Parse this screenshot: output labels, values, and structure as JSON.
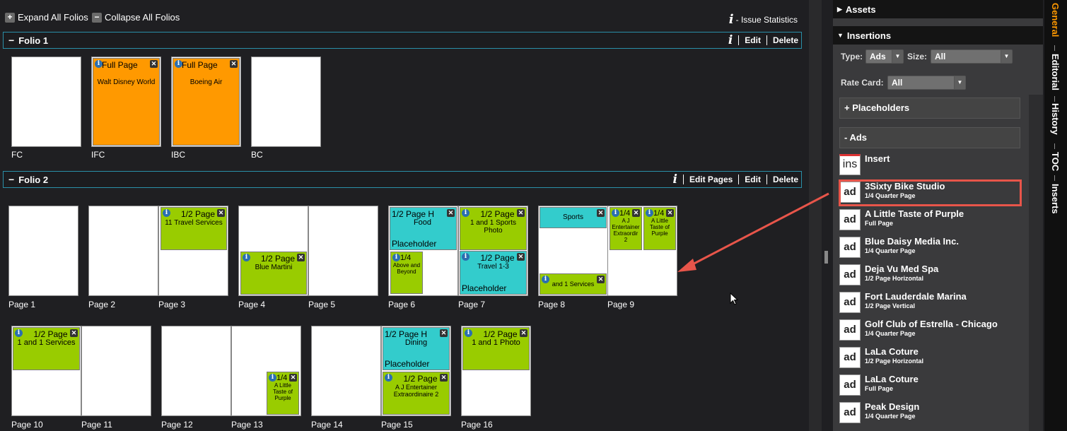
{
  "toolbar": {
    "expand_label": "Expand All Folios",
    "collapse_label": "Collapse All Folios",
    "stats_label": "- Issue Statistics",
    "stats_icon": "i"
  },
  "folios": [
    {
      "title": "Folio 1",
      "actions": [
        "Edit",
        "Delete"
      ]
    },
    {
      "title": "Folio 2",
      "actions": [
        "Edit Pages",
        "Edit",
        "Delete"
      ]
    }
  ],
  "folio1_pages": [
    {
      "label": "FC"
    },
    {
      "label": "IFC",
      "ad": {
        "size": "Full Page",
        "name": "Walt Disney World"
      }
    },
    {
      "label": "IBC",
      "ad": {
        "size": "Full Page",
        "name": "Boeing Air"
      }
    },
    {
      "label": "BC"
    }
  ],
  "folio2_labels": [
    "Page 1",
    "Page 2",
    "Page 3",
    "Page 4",
    "Page 5",
    "Page 6",
    "Page 7",
    "Page 8",
    "Page 9",
    "Page 10",
    "Page 11",
    "Page 12",
    "Page 13",
    "Page 14",
    "Page 15",
    "Page 16"
  ],
  "ads": {
    "p3": {
      "size": "1/2 Page",
      "name": "11 Travel Services"
    },
    "p4": {
      "size": "1/2 Page",
      "name": "Blue Martini"
    },
    "p6a": {
      "size": "1/2 Page H",
      "name": "Food",
      "ph": "Placeholder"
    },
    "p6b": {
      "size": "1/4",
      "name": "Above and Beyond"
    },
    "p7a": {
      "size": "1/2 Page",
      "name": "1 and 1 Sports Photo"
    },
    "p7b": {
      "size": "1/2 Page",
      "name": "Travel 1-3",
      "ph": "Placeholder"
    },
    "p8a": {
      "name": "Sports"
    },
    "p8b": {
      "name": "and 1 Services"
    },
    "p9a": {
      "size": "1/4",
      "name": "A J Entertainer Extraordir 2"
    },
    "p9b": {
      "size": "1/4",
      "name": "A Little Taste of Purple"
    },
    "p10": {
      "size": "1/2 Page",
      "name": "1 and 1 Services"
    },
    "p13": {
      "size": "1/4",
      "name": "A Little Taste of Purple"
    },
    "p15a": {
      "size": "1/2 Page H",
      "name": "Dining",
      "ph": "Placeholder"
    },
    "p15b": {
      "size": "1/2 Page",
      "name": "A J Entertainer Extraordinaire 2"
    },
    "p16": {
      "size": "1/2 Page",
      "name": "1 and 1 Photo"
    }
  },
  "right_panel": {
    "assets": "Assets",
    "insertions": "Insertions",
    "type_label": "Type:",
    "type_value": "Ads",
    "size_label": "Size:",
    "size_value": "All",
    "rate_label": "Rate Card:",
    "rate_value": "All",
    "placeholders": "+ Placeholders",
    "ads_group": "- Ads",
    "insert_icon": "ins",
    "insert_label": "Insert",
    "ad_icon": "ad",
    "items": [
      {
        "name": "3Sixty Bike Studio",
        "sub": "1/4 Quarter Page"
      },
      {
        "name": "A Little Taste of Purple",
        "sub": "Full Page"
      },
      {
        "name": "Blue Daisy Media Inc.",
        "sub": "1/4 Quarter Page"
      },
      {
        "name": "Deja Vu Med Spa",
        "sub": "1/2 Page Horizontal"
      },
      {
        "name": "Fort Lauderdale Marina",
        "sub": "1/2 Page Vertical"
      },
      {
        "name": "Golf Club of Estrella - Chicago",
        "sub": "1/4 Quarter Page"
      },
      {
        "name": "LaLa Coture",
        "sub": "1/2 Page Horizontal"
      },
      {
        "name": "LaLa Coture",
        "sub": "Full Page"
      },
      {
        "name": "Peak Design",
        "sub": "1/4 Quarter Page"
      }
    ]
  },
  "tabs": [
    "General",
    "Editorial",
    "History",
    "TOC",
    "Inserts"
  ],
  "colors": {
    "accent": "#ff9900",
    "highlight": "#e8554a",
    "folio_border": "#2a8fa8",
    "green": "#99cc00",
    "cyan": "#33cccc"
  }
}
